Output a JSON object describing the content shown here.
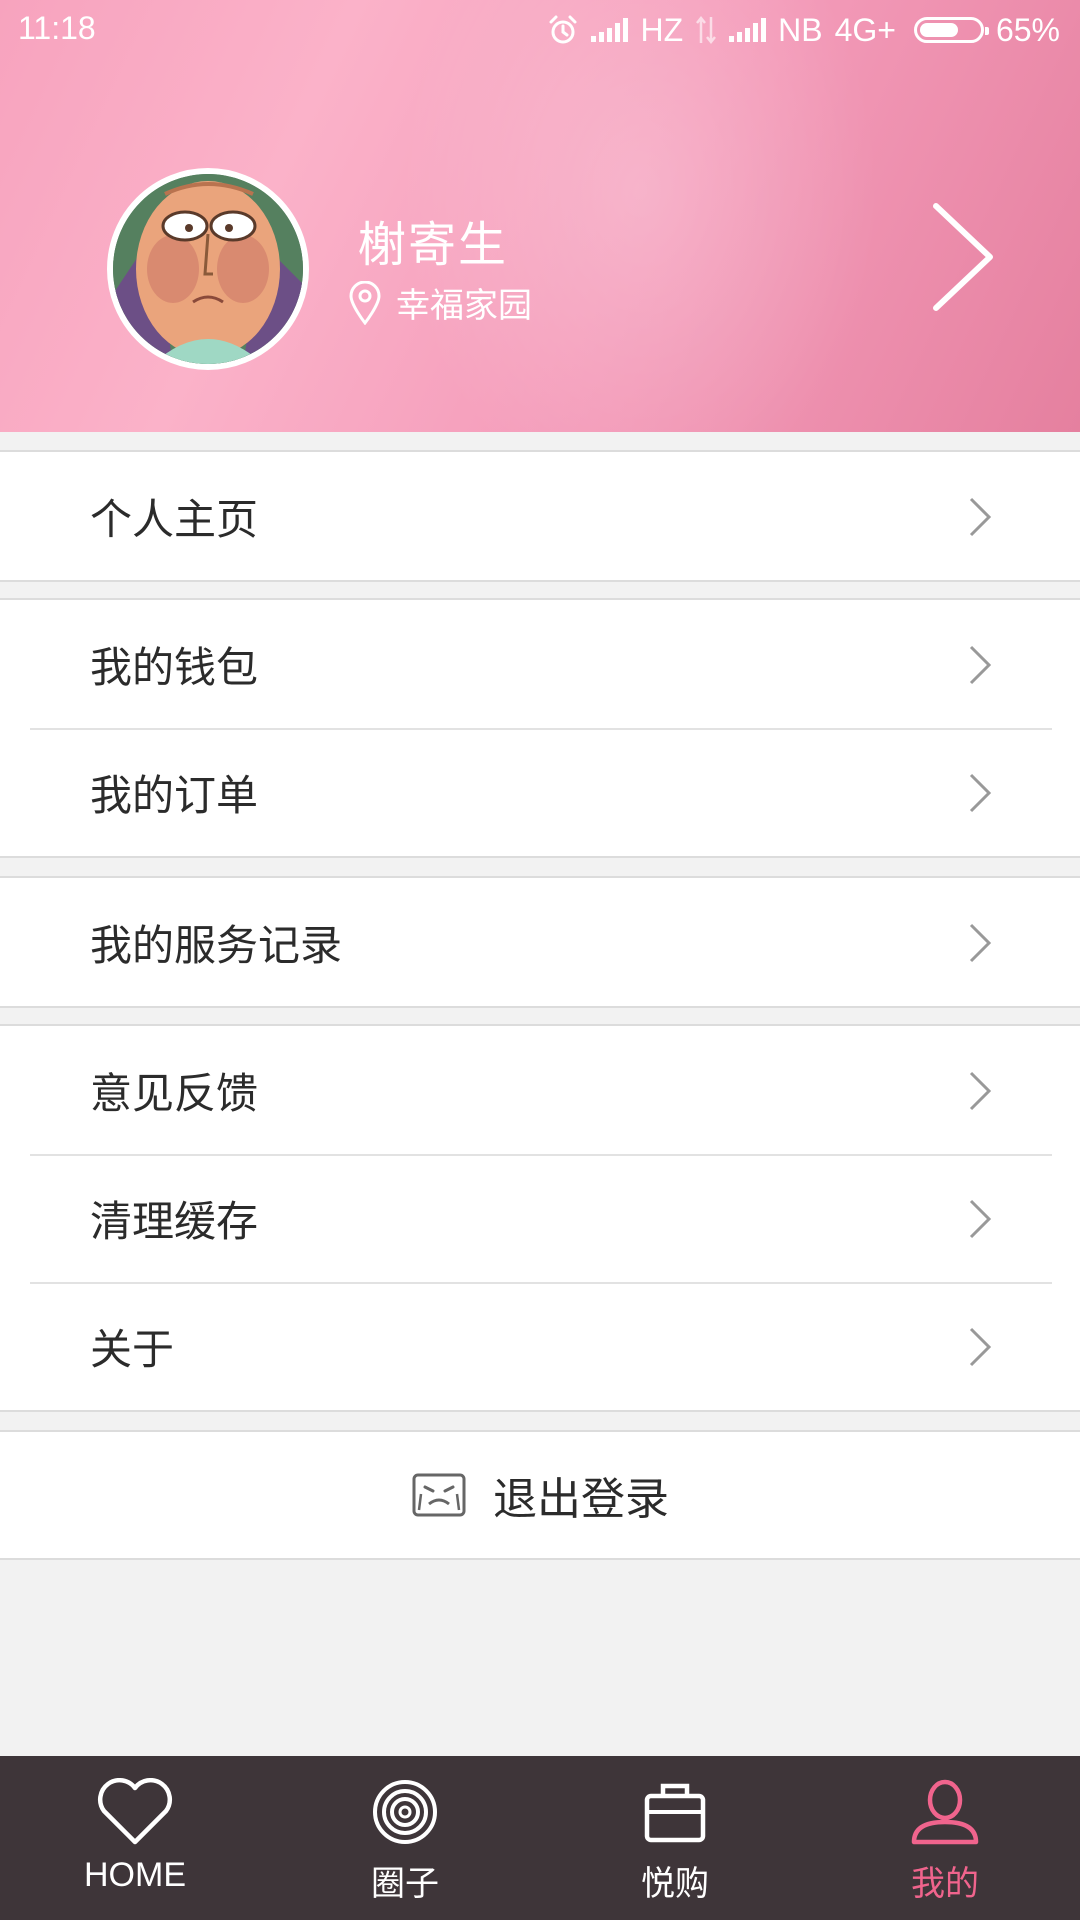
{
  "status_bar": {
    "time": "11:18",
    "carrier1": "HZ",
    "carrier2": "NB",
    "network": "4G+",
    "battery_percent": "65%",
    "battery_level": 0.65
  },
  "profile": {
    "name": "榭寄生",
    "location": "幸福家园"
  },
  "menu": {
    "group1": [
      {
        "label": "个人主页"
      }
    ],
    "group2": [
      {
        "label": "我的钱包"
      },
      {
        "label": "我的订单"
      }
    ],
    "group3": [
      {
        "label": "我的服务记录"
      }
    ],
    "group4": [
      {
        "label": "意见反馈"
      },
      {
        "label": "清理缓存"
      },
      {
        "label": "关于"
      }
    ]
  },
  "logout": {
    "label": "退出登录",
    "icon": "crying-face-icon"
  },
  "tabbar": {
    "items": [
      {
        "label": "HOME",
        "icon": "heart-icon"
      },
      {
        "label": "圈子",
        "icon": "circle-target-icon"
      },
      {
        "label": "悦购",
        "icon": "shopping-bag-icon"
      },
      {
        "label": "我的",
        "icon": "user-icon",
        "active": true
      }
    ]
  },
  "colors": {
    "header_pink": "#f7a3be",
    "accent_active": "#f0648d",
    "tabbar_bg": "#3e3539",
    "page_bg": "#f2f2f2"
  }
}
